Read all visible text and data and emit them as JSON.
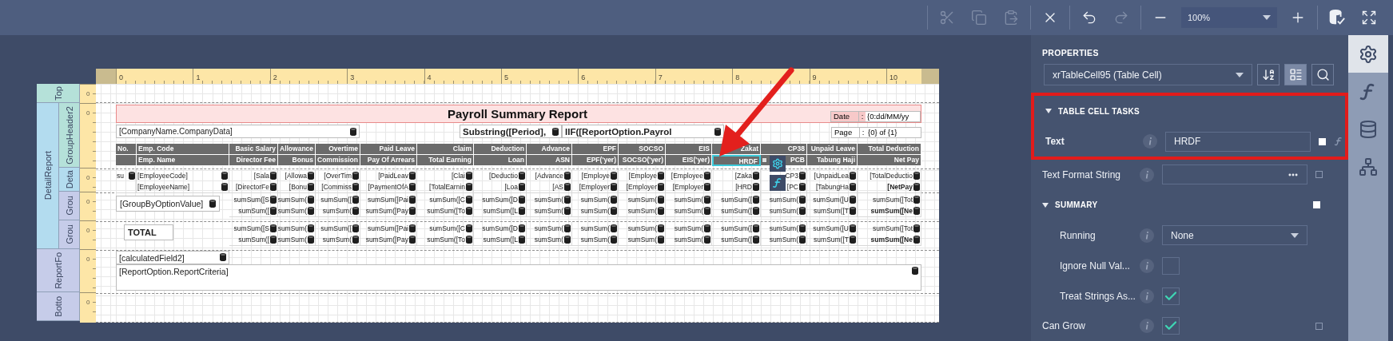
{
  "toolbar": [
    [
      {
        "kind": "cut",
        "disabled": true
      },
      {
        "kind": "copy",
        "disabled": true
      },
      {
        "kind": "paste",
        "disabled": true
      }
    ],
    [
      {
        "kind": "delete",
        "disabled": false
      }
    ],
    [
      {
        "kind": "undo",
        "disabled": false
      },
      {
        "kind": "redo",
        "disabled": true
      }
    ],
    [
      {
        "kind": "zoom_out",
        "disabled": false
      },
      {
        "kind": "zoom",
        "value": "100%"
      },
      {
        "kind": "zoom_in",
        "disabled": false
      }
    ],
    [
      {
        "kind": "validate",
        "disabled": false
      },
      {
        "kind": "fullscreen",
        "disabled": false
      }
    ]
  ],
  "ruler": [
    "0",
    "1",
    "2",
    "3",
    "4",
    "5",
    "6",
    "7",
    "8",
    "9",
    "10"
  ],
  "bands": [
    {
      "kind": "top",
      "label": "Top",
      "ruler": "0"
    },
    {
      "kind": "detail_report",
      "label": "DetailReport",
      "children": [
        {
          "kind": "group_header",
          "label": "GroupHeader2",
          "ruler": "0",
          "title": "Payroll Summary Report",
          "date": {
            "label": "Date",
            "separator": ":",
            "value": "{0:dd/MM/yy"
          },
          "page": {
            "label": "Page",
            "separator": ":",
            "value": "{0} of {1}"
          },
          "fields": [
            {
              "text": "[CompanyName.CompanyData]",
              "bold": false
            },
            {
              "text": "Substring([Period],",
              "bold": true
            },
            {
              "text": "IIF([ReportOption.Payrol",
              "bold": true
            }
          ],
          "columns": [
            {
              "top": "No.",
              "selected": false
            },
            {
              "top": "Emp. Code",
              "bottom": "Emp. Name",
              "selected": false
            },
            {
              "top": "Basic Salary",
              "bottom": "Director Fee",
              "selected": false
            },
            {
              "top": "Allowance",
              "bottom": "Bonus",
              "selected": false
            },
            {
              "top": "Overtime",
              "bottom": "Commission",
              "selected": false
            },
            {
              "top": "Paid Leave",
              "bottom": "Pay Of Arrears",
              "selected": false
            },
            {
              "top": "Claim",
              "bottom": "Total Earning",
              "selected": false
            },
            {
              "top": "Deduction",
              "bottom": "Loan",
              "selected": false
            },
            {
              "top": "Advance",
              "bottom": "ASN",
              "selected": false
            },
            {
              "top": "EPF",
              "bottom": "EPF('yer)",
              "selected": false
            },
            {
              "top": "SOCSO",
              "bottom": "SOCSO('yer)",
              "selected": false
            },
            {
              "top": "EIS",
              "bottom": "EIS('yer)",
              "selected": false
            },
            {
              "top": "Zakat",
              "bottom": "HRDF",
              "selected": true
            },
            {
              "top": "CP38",
              "bottom": "PCB",
              "selected": false
            },
            {
              "top": "Unpaid Leave",
              "bottom": "Tabung Haji",
              "selected": false
            },
            {
              "top": "Total Deduction",
              "bottom": "Net Pay",
              "selected": false
            }
          ]
        },
        {
          "kind": "detail",
          "label": "Deta",
          "ruler": "0",
          "cells": [
            {
              "lines": [
                "su"
              ]
            },
            {
              "lines": [
                "[EmployeeCode]",
                "[EmployeeName]"
              ]
            },
            {
              "lines": [
                "[Sala",
                "[DirectorFe"
              ]
            },
            {
              "lines": [
                "[Allowa",
                "[Bonu"
              ]
            },
            {
              "lines": [
                "[OverTim",
                "[Commiss"
              ]
            },
            {
              "lines": [
                "[PaidLeav",
                "[PaymentOfA"
              ]
            },
            {
              "lines": [
                "[Clai",
                "[TotalEarnin"
              ]
            },
            {
              "lines": [
                "[Deductio",
                "[Loa"
              ]
            },
            {
              "lines": [
                "[Advance",
                "[AS"
              ]
            },
            {
              "lines": [
                "[Employe",
                "[Employer"
              ]
            },
            {
              "lines": [
                "[Employe",
                "[Employer"
              ]
            },
            {
              "lines": [
                "[Employee",
                "[Employer"
              ]
            },
            {
              "lines": [
                "[Zaka",
                "[HRD"
              ]
            },
            {
              "lines": [
                "CP3",
                "[PC"
              ]
            },
            {
              "lines": [
                "[UnpaidLea",
                "[TabungHa"
              ]
            },
            {
              "lines": [
                "[TotalDeductio",
                "[NetPay"
              ],
              "emphasis": true
            }
          ]
        },
        {
          "kind": "group_footer",
          "label": "Grou",
          "ruler": "0",
          "caption": "[GroupByOptionValue]",
          "caption_bold": false,
          "caption_bound": true,
          "cells": [
            {
              "lines": [
                "sumSum([S",
                "sumSum(["
              ]
            },
            {
              "lines": [
                "sumSum(",
                "sumSum("
              ]
            },
            {
              "lines": [
                "sumSum([",
                "sumSum("
              ]
            },
            {
              "lines": [
                "sumSum([Pai",
                "sumSum([Pay"
              ]
            },
            {
              "lines": [
                "sumSum([C",
                "sumSum([To"
              ]
            },
            {
              "lines": [
                "sumSum([D",
                "sumSum([L"
              ]
            },
            {
              "lines": [
                "sumSum(",
                "sumSum("
              ]
            },
            {
              "lines": [
                "sumSum(",
                "sumSum("
              ]
            },
            {
              "lines": [
                "sumSum(",
                "sumSum("
              ]
            },
            {
              "lines": [
                "sumSum(",
                "sumSum("
              ]
            },
            {
              "lines": [
                "sumSum([",
                "sumSum(["
              ]
            },
            {
              "lines": [
                "sumSum(",
                "sumSum("
              ]
            },
            {
              "lines": [
                "sumSum([U",
                "sumSum([T"
              ]
            },
            {
              "lines": [
                "sumSum([Tot",
                "sumSum([Ne"
              ],
              "emphasis": true
            }
          ]
        },
        {
          "kind": "group_footer",
          "label": "Grou",
          "ruler": "0",
          "caption": "TOTAL",
          "caption_bold": true,
          "caption_bound": false,
          "cells": [
            {
              "lines": [
                "sumSum([S",
                "sumSum(["
              ]
            },
            {
              "lines": [
                "sumSum(",
                "sumSum("
              ]
            },
            {
              "lines": [
                "sumSum([",
                "sumSum("
              ]
            },
            {
              "lines": [
                "sumSum([Pai",
                "sumSum([Pay"
              ]
            },
            {
              "lines": [
                "sumSum([C",
                "sumSum([To"
              ]
            },
            {
              "lines": [
                "sumSum([D",
                "sumSum([L"
              ]
            },
            {
              "lines": [
                "sumSum(",
                "sumSum("
              ]
            },
            {
              "lines": [
                "sumSum(",
                "sumSum("
              ]
            },
            {
              "lines": [
                "sumSum(",
                "sumSum("
              ]
            },
            {
              "lines": [
                "sumSum(",
                "sumSum("
              ]
            },
            {
              "lines": [
                "sumSum([",
                "sumSum(["
              ]
            },
            {
              "lines": [
                "sumSum(",
                "sumSum("
              ]
            },
            {
              "lines": [
                "sumSum([U",
                "sumSum([T"
              ]
            },
            {
              "lines": [
                "sumSum([Tot",
                "sumSum([Ne"
              ],
              "emphasis": true
            }
          ]
        }
      ]
    },
    {
      "kind": "report_footer",
      "label": "ReportFo",
      "ruler": "0",
      "fields": [
        {
          "text": "[calculatedField2]",
          "wide": false
        },
        {
          "text": "[ReportOption.ReportCriteria]",
          "wide": true
        }
      ]
    },
    {
      "kind": "bottom",
      "label": "Botto",
      "ruler": "0"
    }
  ],
  "properties": {
    "title": "PROPERTIES",
    "selector": "xrTableCell95 (Table Cell)",
    "tools": [
      {
        "kind": "sort",
        "selected": false
      },
      {
        "kind": "categories",
        "selected": true
      },
      {
        "kind": "search",
        "selected": false
      }
    ],
    "items": [
      {
        "kind": "section",
        "label": "TABLE CELL TASKS",
        "expanded": true,
        "highlighted": true,
        "children": [
          {
            "kind": "input",
            "label": "Text",
            "value": "HRDF",
            "modified": true
          }
        ]
      },
      {
        "kind": "ellipsis",
        "label": "Text Format String",
        "modified": false
      },
      {
        "kind": "section",
        "label": "SUMMARY",
        "expanded": true,
        "highlighted": false,
        "modified": true,
        "children": [
          {
            "kind": "select",
            "label": "Running",
            "value": "None"
          },
          {
            "kind": "checkbox",
            "label": "Ignore Null Val...",
            "checked": false
          },
          {
            "kind": "checkbox",
            "label": "Treat Strings As...",
            "checked": true
          }
        ]
      },
      {
        "kind": "checkbox",
        "label": "Can Grow",
        "checked": true,
        "modified": false
      }
    ]
  },
  "side_tabs": [
    {
      "kind": "properties",
      "selected": true
    },
    {
      "kind": "expressions",
      "selected": false
    },
    {
      "kind": "data",
      "selected": false
    },
    {
      "kind": "outline",
      "selected": false
    }
  ]
}
